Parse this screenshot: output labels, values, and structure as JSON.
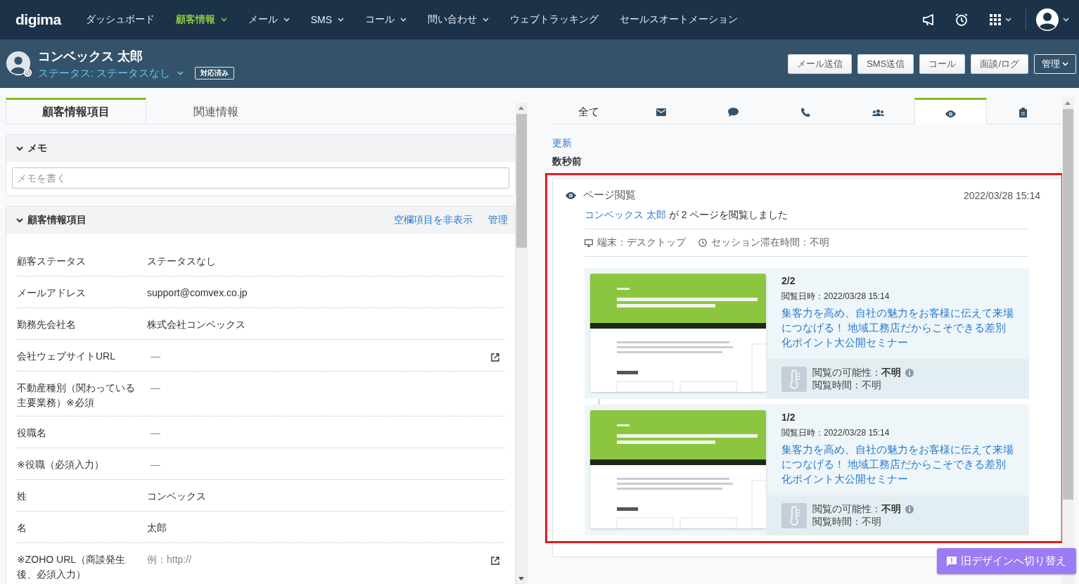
{
  "nav": {
    "logo": "digima",
    "items": [
      {
        "label": "ダッシュボード",
        "selected": false,
        "dropdown": false
      },
      {
        "label": "顧客情報",
        "selected": true,
        "dropdown": true
      },
      {
        "label": "メール",
        "selected": false,
        "dropdown": true
      },
      {
        "label": "SMS",
        "selected": false,
        "dropdown": true
      },
      {
        "label": "コール",
        "selected": false,
        "dropdown": true
      },
      {
        "label": "問い合わせ",
        "selected": false,
        "dropdown": true
      },
      {
        "label": "ウェブトラッキング",
        "selected": false,
        "dropdown": false
      },
      {
        "label": "セールスオートメーション",
        "selected": false,
        "dropdown": false
      }
    ]
  },
  "customer": {
    "name": "コンベックス 太郎",
    "status": "ステータス: ステータスなし",
    "badge": "対応済み",
    "actions": [
      {
        "label": "メール送信",
        "kind": "button"
      },
      {
        "label": "SMS送信",
        "kind": "button"
      },
      {
        "label": "コール",
        "kind": "button"
      },
      {
        "label": "面談/ログ",
        "kind": "button"
      },
      {
        "label": "管理",
        "kind": "menu"
      }
    ]
  },
  "left_tabs": [
    {
      "label": "顧客情報項目",
      "selected": true
    },
    {
      "label": "関連情報",
      "selected": false
    }
  ],
  "memo": {
    "title": "メモ",
    "expanded": true,
    "placeholder": "メモを書く"
  },
  "fields_section": {
    "title": "顧客情報項目",
    "expanded": true,
    "links": [
      "空欄項目を非表示",
      "管理"
    ],
    "rows": [
      {
        "label": "顧客ステータス",
        "value": "ステータスなし",
        "kind": "text",
        "link_icon": false
      },
      {
        "label": "メールアドレス",
        "value": "support@comvex.co.jp",
        "kind": "text",
        "link_icon": false
      },
      {
        "label": "勤務先会社名",
        "value": "株式会社コンベックス",
        "kind": "text",
        "link_icon": false
      },
      {
        "label": "会社ウェブサイトURL",
        "value": "—",
        "kind": "empty",
        "link_icon": true
      },
      {
        "label": "不動産種別（関わっている主要業務）※必須",
        "value": "—",
        "kind": "empty",
        "link_icon": false
      },
      {
        "label": "役職名",
        "value": "—",
        "kind": "empty",
        "link_icon": false
      },
      {
        "label": "※役職（必須入力）",
        "value": "—",
        "kind": "empty",
        "link_icon": false
      },
      {
        "label": "姓",
        "value": "コンベックス",
        "kind": "text",
        "link_icon": false
      },
      {
        "label": "名",
        "value": "太郎",
        "kind": "text",
        "link_icon": false
      },
      {
        "label": "※ZOHO URL（商談発生後、必須入力）",
        "value": "例：http://",
        "kind": "placeholder",
        "link_icon": true
      }
    ]
  },
  "activity_tabs": [
    {
      "kind": "all",
      "label": "全て",
      "selected": false
    },
    {
      "kind": "mail",
      "selected": false
    },
    {
      "kind": "chat",
      "selected": false
    },
    {
      "kind": "call",
      "selected": false
    },
    {
      "kind": "meeting",
      "selected": false
    },
    {
      "kind": "view",
      "selected": true
    },
    {
      "kind": "form",
      "selected": false
    }
  ],
  "refresh": "更新",
  "time_group": "数秒前",
  "activity": {
    "highlighted": true,
    "title": "ページ閲覧",
    "datetime": "2022/03/28 15:14",
    "actor": "コンベックス 太郎",
    "summary": "が 2 ページを閲覧しました",
    "device": "端末：デスクトップ",
    "session": "セッション滞在時間：不明",
    "pages": [
      {
        "counter": "2/2",
        "viewed_at": "閲覧日時：2022/03/28 15:14",
        "title": "集客力を高め、自社の魅力をお客様に伝えて来場につなげる！ 地域工務店だからこそできる差別化ポイント大公開セミナー",
        "likelihood_label": "閲覧の可能性：",
        "likelihood": "不明",
        "duration": "閲覧時間：不明"
      },
      {
        "counter": "1/2",
        "viewed_at": "閲覧日時：2022/03/28 15:14",
        "title": "集客力を高め、自社の魅力をお客様に伝えて来場につなげる！ 地域工務店だからこそできる差別化ポイント大公開セミナー",
        "likelihood_label": "閲覧の可能性：",
        "likelihood": "不明",
        "duration": "閲覧時間：不明"
      }
    ]
  },
  "switch_button": "旧デザインへ切り替え"
}
